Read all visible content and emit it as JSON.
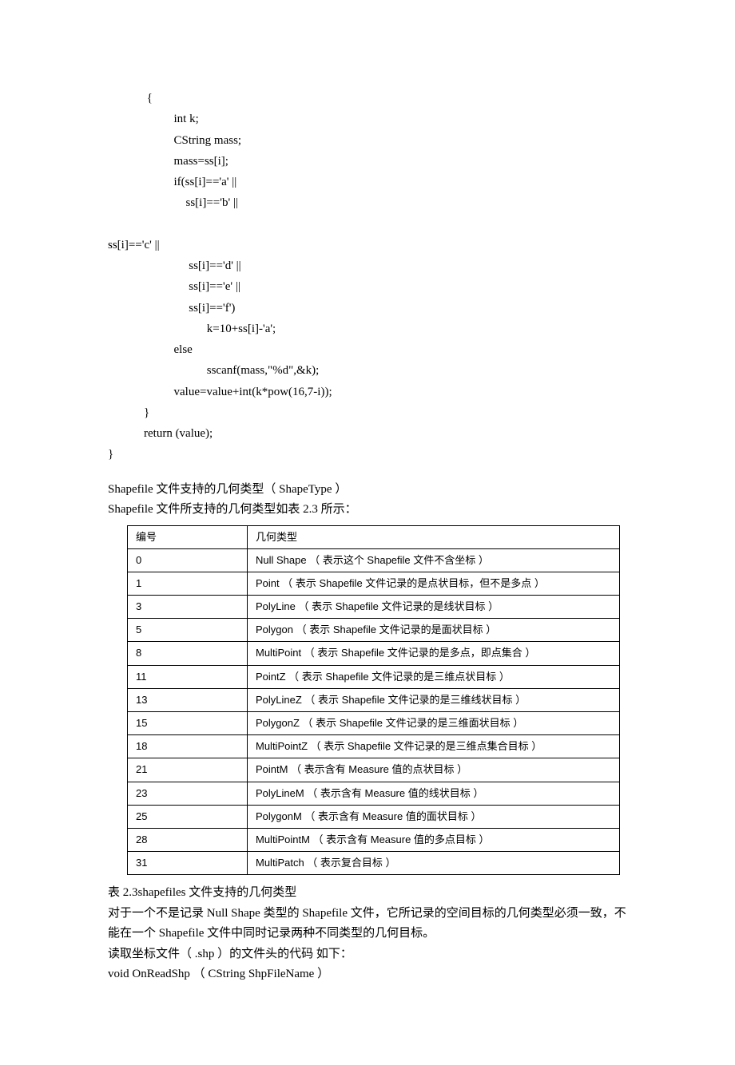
{
  "code_block": "             {\n                      int k;\n                      CString mass;\n                      mass=ss[i];\n                      if(ss[i]=='a' ||\n                          ss[i]=='b' ||\n\nss[i]=='c' ||\n                           ss[i]=='d' ||\n                           ss[i]=='e' ||\n                           ss[i]=='f')\n                                 k=10+ss[i]-'a';\n                      else\n                                 sscanf(mass,\"%d\",&k);\n                      value=value+int(k*pow(16,7-i));\n            }\n            return (value);\n}",
  "para1": "Shapefile  文件支持的几何类型（  ShapeType  ）",
  "para2": "Shapefile  文件所支持的几何类型如表  2.3  所示：",
  "table": {
    "header": {
      "col1": "编号",
      "col2": "几何类型"
    },
    "rows": [
      {
        "id": "0",
        "desc": "Null Shape （ 表示这个  Shapefile 文件不含坐标 ）"
      },
      {
        "id": "1",
        "desc": "Point （ 表示  Shapefile 文件记录的是点状目标，但不是多点 ）"
      },
      {
        "id": "3",
        "desc": "PolyLine （ 表示  Shapefile 文件记录的是线状目标 ）"
      },
      {
        "id": "5",
        "desc": "Polygon （ 表示  Shapefile 文件记录的是面状目标 ）"
      },
      {
        "id": "8",
        "desc": "MultiPoint （ 表示  Shapefile 文件记录的是多点，即点集合 ）"
      },
      {
        "id": "11",
        "desc": "PointZ （ 表示  Shapefile 文件记录的是三维点状目标 ）"
      },
      {
        "id": "13",
        "desc": "PolyLineZ （ 表示  Shapefile 文件记录的是三维线状目标 ）"
      },
      {
        "id": "15",
        "desc": "PolygonZ （ 表示  Shapefile 文件记录的是三维面状目标 ）"
      },
      {
        "id": "18",
        "desc": "MultiPointZ （ 表示  Shapefile 文件记录的是三维点集合目标 ）"
      },
      {
        "id": "21",
        "desc": "PointM （ 表示含有  Measure 值的点状目标 ）"
      },
      {
        "id": "23",
        "desc": "PolyLineM （ 表示含有  Measure 值的线状目标 ）"
      },
      {
        "id": "25",
        "desc": "PolygonM （ 表示含有  Measure 值的面状目标 ）"
      },
      {
        "id": "28",
        "desc": "MultiPointM （ 表示含有  Measure 值的多点目标 ）"
      },
      {
        "id": "31",
        "desc": "MultiPatch （ 表示复合目标 ）"
      }
    ]
  },
  "caption": "表  2.3shapefiles  文件支持的几何类型",
  "para3": "对于一个不是记录  Null Shape  类型的  Shapefile  文件，它所记录的空间目标的几何类型必须一致，不能在一个  Shapefile  文件中同时记录两种不同类型的几何目标。",
  "para4": "读取坐标文件（ .shp  ）的文件头的代码  如下：",
  "para5": "void OnReadShp  （  CString ShpFileName  ）"
}
